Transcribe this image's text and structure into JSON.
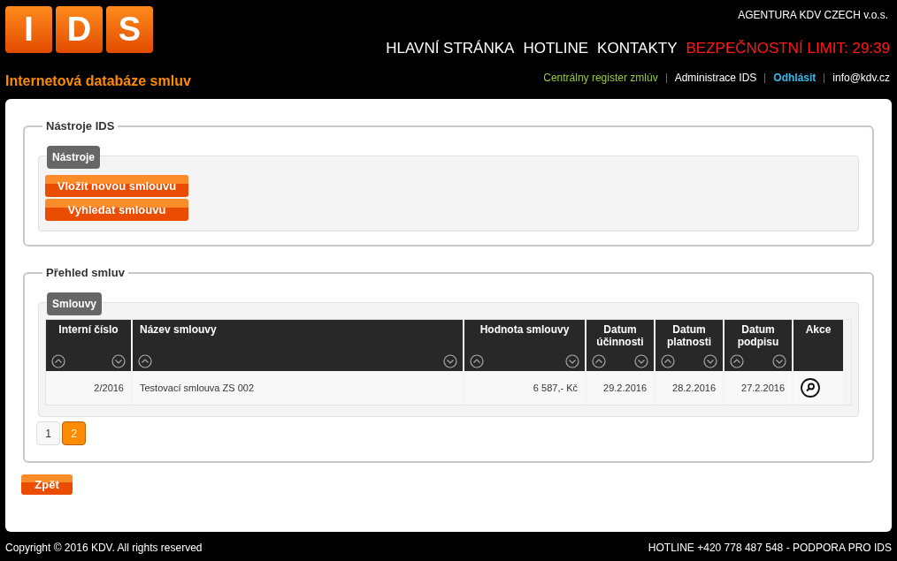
{
  "logo": {
    "letters": [
      "I",
      "D",
      "S"
    ]
  },
  "company": "AGENTURA KDV CZECH v.o.s.",
  "nav": [
    "HLAVNÍ STRÁNKA",
    "HOTLINE",
    "KONTAKTY"
  ],
  "security_limit": "BEZPEČNOSTNÍ LIMIT: 29:39",
  "site_title": "Internetová databáze smluv",
  "top_links": [
    {
      "label": "Centrálny register zmlúv",
      "color": "#99cc33"
    },
    {
      "label": "Administrace IDS",
      "color": "#ffffff"
    },
    {
      "label": "Odhlásit",
      "color": "#33bbee"
    },
    {
      "label": "info@kdv.cz",
      "color": "#ffffff"
    }
  ],
  "tools_section": {
    "legend": "Nástroje IDS",
    "tab": "Nástroje",
    "buttons": [
      "Vložit novou smlouvu",
      "Vyhledat smlouvu"
    ]
  },
  "contracts_section": {
    "legend": "Přehled smluv",
    "tab": "Smlouvy",
    "table": {
      "columns": [
        {
          "label": "Interní číslo",
          "sortable": true
        },
        {
          "label": "Název smlouvy",
          "sortable": true
        },
        {
          "label": "Hodnota smlouvy",
          "sortable": true
        },
        {
          "label": "Datum účinnosti",
          "sortable": true
        },
        {
          "label": "Datum platnosti",
          "sortable": true
        },
        {
          "label": "Datum podpisu",
          "sortable": true
        },
        {
          "label": "Akce",
          "sortable": false
        }
      ],
      "rows": [
        {
          "cells": [
            "2/2016",
            "Testovací smlouva ZS 002",
            "6 587,- Kč",
            "29.2.2016",
            "28.2.2016",
            "27.2.2016"
          ]
        }
      ]
    },
    "pages": [
      {
        "label": "1",
        "selected": false
      },
      {
        "label": "2",
        "selected": true
      }
    ]
  },
  "back_button": "Zpět",
  "footer": {
    "copyright": "Copyright © 2016 KDV. All rights reserved",
    "hotline": "HOTLINE +420 778 487 548 - PODPORA PRO IDS"
  }
}
